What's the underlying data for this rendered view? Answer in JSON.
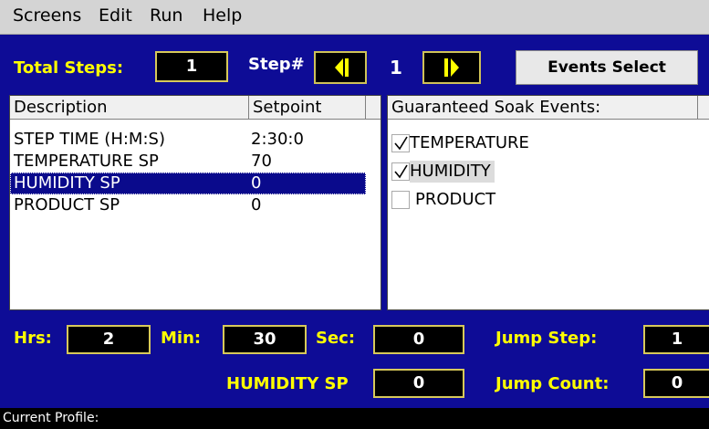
{
  "menu": [
    "Screens",
    "Edit",
    "Run",
    "Help"
  ],
  "top": {
    "total_steps_label": "Total Steps:",
    "total_steps_value": "1",
    "step_label": "Step#",
    "step_value": "1",
    "events_select": "Events Select"
  },
  "steps_table": {
    "headers": [
      "Description",
      "Setpoint"
    ],
    "rows": [
      {
        "description": "STEP TIME (H:M:S)",
        "setpoint": "2:30:0",
        "selected": false
      },
      {
        "description": "TEMPERATURE SP",
        "setpoint": "70",
        "selected": false
      },
      {
        "description": "HUMIDITY SP",
        "setpoint": "0",
        "selected": true
      },
      {
        "description": "PRODUCT SP",
        "setpoint": "0",
        "selected": false
      }
    ]
  },
  "soak_table": {
    "header": "Guaranteed Soak Events:",
    "items": [
      {
        "label": "TEMPERATURE",
        "checked": true
      },
      {
        "label": "HUMIDITY",
        "checked": true
      },
      {
        "label": "PRODUCT",
        "checked": false
      }
    ]
  },
  "time": {
    "hrs_label": "Hrs:",
    "hrs_value": "2",
    "min_label": "Min:",
    "min_value": "30",
    "sec_label": "Sec:",
    "sec_value": "0"
  },
  "jump": {
    "jump_step_label": "Jump Step:",
    "jump_step_value": "1",
    "jump_count_label": "Jump Count:",
    "jump_count_value": "0"
  },
  "edit_field": {
    "label": "HUMIDITY SP",
    "value": "0"
  },
  "status_bar": {
    "current_profile_label": "Current Profile:"
  },
  "colors": {
    "panel_blue": "#0e0c96",
    "label_yellow": "#ffff00",
    "selection": "#0a0a8c"
  }
}
